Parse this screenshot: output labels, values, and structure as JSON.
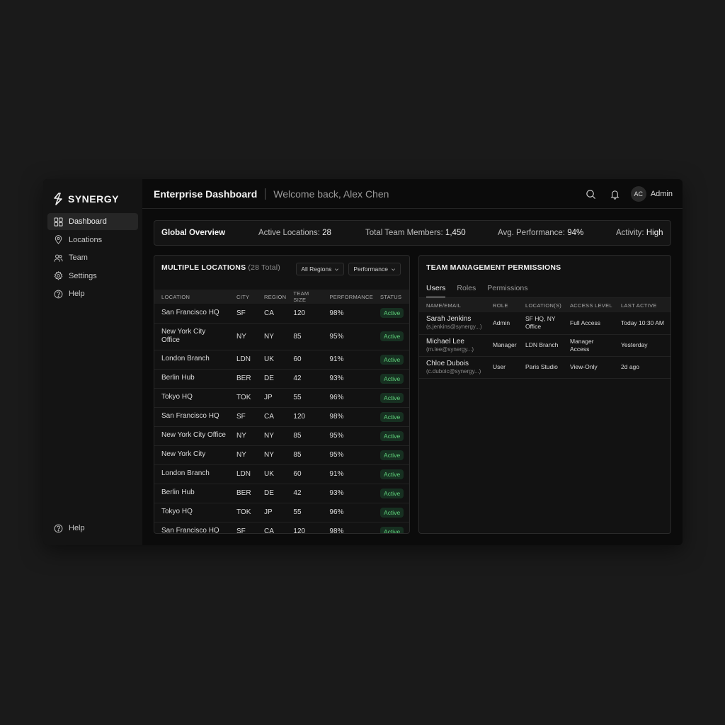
{
  "brand": {
    "name": "SYNERGY"
  },
  "sidebar": {
    "items": [
      {
        "label": "Dashboard",
        "icon": "grid-icon",
        "active": true
      },
      {
        "label": "Locations",
        "icon": "pin-icon"
      },
      {
        "label": "Team",
        "icon": "users-icon"
      },
      {
        "label": "Settings",
        "icon": "gear-icon"
      },
      {
        "label": "Help",
        "icon": "help-icon"
      }
    ],
    "bottom_item": {
      "label": "Help",
      "icon": "help-icon"
    }
  },
  "header": {
    "title": "Enterprise Dashboard",
    "welcome": "Welcome back, Alex Chen",
    "avatar_initials": "AC",
    "user_label": "Admin"
  },
  "overview": {
    "title": "Global Overview",
    "active_locations_label": "Active Locations:",
    "active_locations_value": "28",
    "team_members_label": "Total Team Members:",
    "team_members_value": "1,450",
    "performance_label": "Avg. Performance:",
    "performance_value": "94%",
    "activity_label": "Activity:",
    "activity_value": "High"
  },
  "locations": {
    "title": "MULTIPLE LOCATIONS",
    "count_text": "(28 Total)",
    "filter_region": "All Regions",
    "filter_sort": "Performance",
    "columns": [
      "LOCATION",
      "CITY",
      "REGION",
      "TEAM SIZE",
      "PERFORMANCE",
      "STATUS"
    ],
    "rows": [
      {
        "location": "San Francisco HQ",
        "city": "SF",
        "region": "CA",
        "team": "120",
        "perf": "98%",
        "status": "Active"
      },
      {
        "location": "New York City Office",
        "city": "NY",
        "region": "NY",
        "team": "85",
        "perf": "95%",
        "status": "Active",
        "wrap": true
      },
      {
        "location": "London Branch",
        "city": "LDN",
        "region": "UK",
        "team": "60",
        "perf": "91%",
        "status": "Active"
      },
      {
        "location": "Berlin Hub",
        "city": "BER",
        "region": "DE",
        "team": "42",
        "perf": "93%",
        "status": "Active"
      },
      {
        "location": "Tokyo HQ",
        "city": "TOK",
        "region": "JP",
        "team": "55",
        "perf": "96%",
        "status": "Active"
      },
      {
        "location": "San Francisco HQ",
        "city": "SF",
        "region": "CA",
        "team": "120",
        "perf": "98%",
        "status": "Active"
      },
      {
        "location": "New York City Office",
        "city": "NY",
        "region": "NY",
        "team": "85",
        "perf": "95%",
        "status": "Active"
      },
      {
        "location": "New York City",
        "city": "NY",
        "region": "NY",
        "team": "85",
        "perf": "95%",
        "status": "Active"
      },
      {
        "location": "London Branch",
        "city": "LDN",
        "region": "UK",
        "team": "60",
        "perf": "91%",
        "status": "Active"
      },
      {
        "location": "Berlin Hub",
        "city": "BER",
        "region": "DE",
        "team": "42",
        "perf": "93%",
        "status": "Active"
      },
      {
        "location": "Tokyo HQ",
        "city": "TOK",
        "region": "JP",
        "team": "55",
        "perf": "96%",
        "status": "Active"
      },
      {
        "location": "San Francisco HQ",
        "city": "SF",
        "region": "CA",
        "team": "120",
        "perf": "98%",
        "status": "Active"
      }
    ]
  },
  "permissions": {
    "title": "TEAM MANAGEMENT PERMISSIONS",
    "tabs": [
      "Users",
      "Roles",
      "Permissions"
    ],
    "active_tab": "Users",
    "columns": [
      "NAME/EMAIL",
      "ROLE",
      "LOCATION(S)",
      "ACCESS LEVEL",
      "LAST ACTIVE"
    ],
    "rows": [
      {
        "name": "Sarah Jenkins",
        "email": "(s.jenkins@synergy...)",
        "role": "Admin",
        "location": "SF HQ, NY Office",
        "access": "Full Access",
        "last": "Today 10:30 AM"
      },
      {
        "name": "Michael Lee",
        "email": "(m.lee@synergy...)",
        "role": "Manager",
        "location": "LDN Branch",
        "access": "Manager Access",
        "last": "Yesterday"
      },
      {
        "name": "Chloe Dubois",
        "email": "(c.duboic@synergy...)",
        "role": "User",
        "location": "Paris Studio",
        "access": "View-Only",
        "last": "2d ago"
      }
    ]
  },
  "colors": {
    "accent_active": "#5fd07a",
    "badge_bg": "#173021",
    "background": "#1a1a1a",
    "panel": "#121212"
  }
}
